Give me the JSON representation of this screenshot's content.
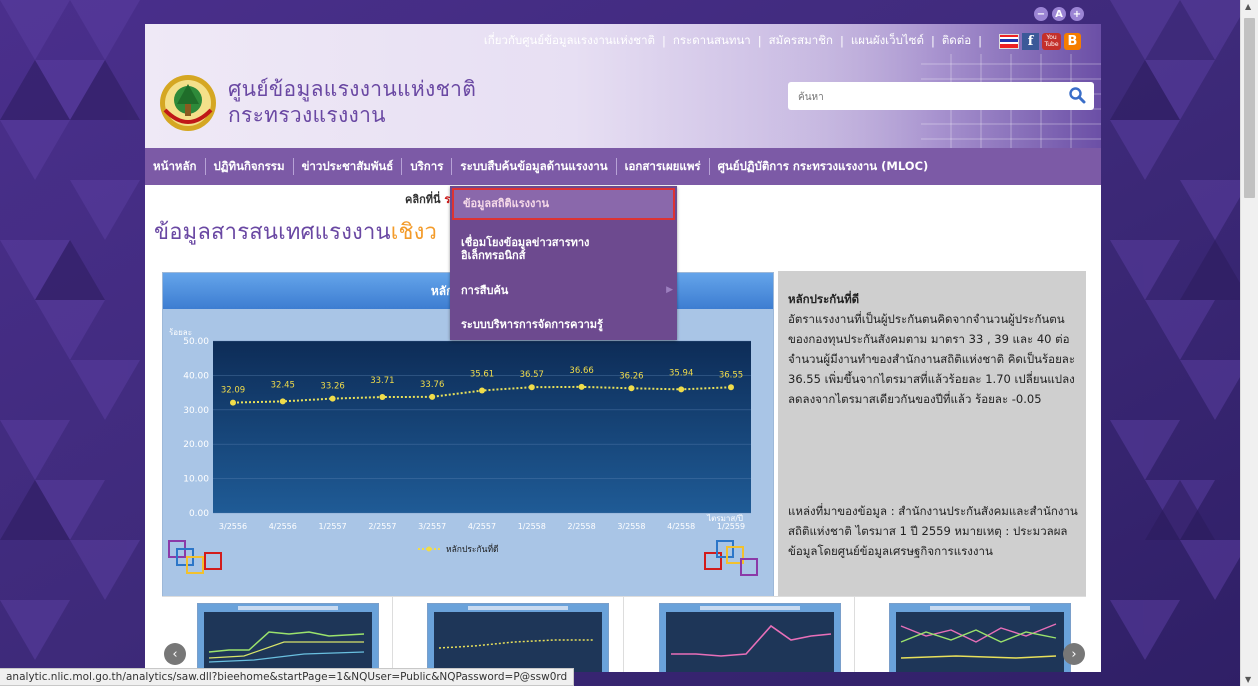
{
  "colors": {
    "accent_purple": "#7c5aa6",
    "title_purple": "#6a48a3",
    "highlight_orange": "#f39b2a",
    "dropdown_bg": "#6d4a8f",
    "selected_border": "#dd3333"
  },
  "font_tools": [
    "−",
    "A",
    "+"
  ],
  "top_links": [
    "เกี่ยวกับศูนย์ข้อมูลแรงงานแห่งชาติ",
    "กระดานสนทนา",
    "สมัครสมาชิก",
    "แผนผังเว็บไซต์",
    "ติดต่อ"
  ],
  "social_icons": [
    "flag-icon",
    "facebook-icon",
    "youtube-icon",
    "blogger-icon"
  ],
  "social": {
    "fb": "f",
    "yt": "You Tube",
    "bl": "B"
  },
  "site_title": {
    "line1": "ศูนย์ข้อมูลแรงงานแห่งชาติ",
    "line2": "กระทรวงแรงงาน"
  },
  "search": {
    "placeholder": "ค้นหา",
    "icon": "search-icon"
  },
  "nav": [
    "หน้าหลัก",
    "ปฏิทินกิจกรรม",
    "ข่าวประชาสัมพันธ์",
    "บริการ",
    "ระบบสืบค้นข้อมูลด้านแรงงาน",
    "เอกสารเผยแพร่",
    "ศูนย์ปฏิบัติการ กระทรวงแรงงาน (MLOC)"
  ],
  "marquee": {
    "prefix": "คลิกที่นี่ ",
    "highlight": "รายง"
  },
  "section_title": {
    "main": "ข้อมูลสารสนเทศแรงงาน",
    "orange": "เชิงว"
  },
  "dropdown": [
    {
      "label": "ข้อมูลสถิติแรงงาน",
      "selected": true
    },
    {
      "label": "เชื่อมโยงข้อมูลข่าวสารทางอิเล็กทรอนิกส์",
      "line1": "เชื่อมโยงข้อมูลข่าวสารทาง",
      "line2": "อิเล็กทรอนิกส์"
    },
    {
      "label": "การสืบค้น",
      "has_submenu": true
    },
    {
      "label": "ระบบบริหารการจัดการความรู้"
    }
  ],
  "chart_header": "หลักประกันที่ดี",
  "chart_data": {
    "type": "line",
    "title": "หลักประกันที่ดี",
    "ylabel": "ร้อยละ",
    "xlabel": "ไตรมาส/ปี",
    "ylim": [
      0,
      50
    ],
    "yticks": [
      "0.00",
      "10.00",
      "20.00",
      "30.00",
      "40.00",
      "50.00"
    ],
    "categories": [
      "3/2556",
      "4/2556",
      "1/2557",
      "2/2557",
      "3/2557",
      "4/2557",
      "1/2558",
      "2/2558",
      "3/2558",
      "4/2558",
      "1/2559"
    ],
    "series": [
      {
        "name": "หลักประกันที่ดี",
        "values": [
          32.09,
          32.45,
          33.26,
          33.71,
          33.76,
          35.61,
          36.57,
          36.66,
          36.26,
          35.94,
          36.55
        ]
      }
    ],
    "value_labels": [
      "32.09",
      "32.45",
      "33.26",
      "33.71",
      "33.76",
      "35.61",
      "36.57",
      "36.66",
      "36.26",
      "35.94",
      "36.55"
    ],
    "legend": "bottom-center",
    "grid": true
  },
  "info": {
    "title": "หลักประกันที่ดี",
    "body": "อัตราแรงงานที่เป็นผู้ประกันตนคิดจากจำนวนผู้ประกันตนของกองทุนประกันสังคมตาม มาตรา 33 , 39 และ 40 ต่อจำนวนผู้มีงานทำของสำนักงานสถิติแห่งชาติ คิดเป็นร้อยละ 36.55 เพิ่มขึ้นจากไตรมาสที่แล้วร้อยละ 1.70 เปลี่ยนแปลงลดลงจากไตรมาสเดียวกันของปีที่แล้ว ร้อยละ -0.05",
    "source": "แหล่งที่มาของข้อมูล : สำนักงานประกันสังคมและสำนักงานสถิติแห่งชาติ ไตรมาส 1 ปี 2559 หมายเหตุ : ประมวลผลข้อมูลโดยศูนย์ข้อมูลเศรษฐกิจการแรงงาน"
  },
  "carousel": {
    "prev_icon": "‹",
    "next_icon": "›"
  },
  "status_url": "analytic.nlic.mol.go.th/analytics/saw.dll?bieehome&startPage=1&NQUser=Public&NQPassword=P@ssw0rd"
}
